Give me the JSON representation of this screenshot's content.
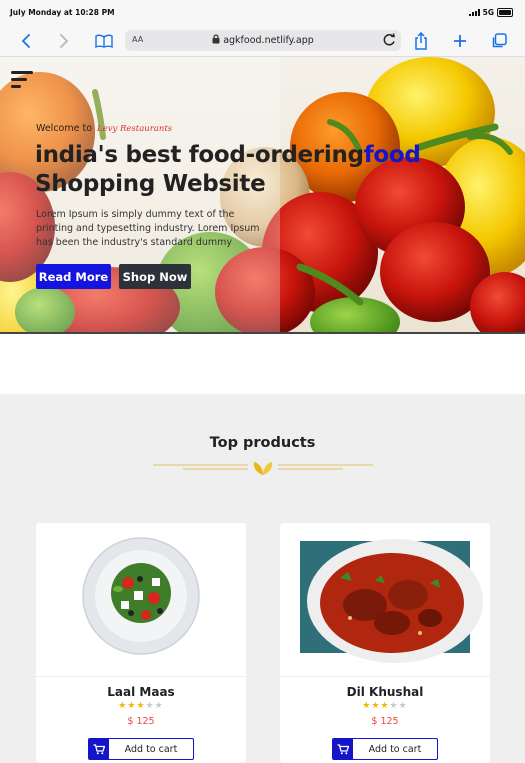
{
  "status_bar": {
    "time": "July Monday at 10:28 PM",
    "network": "5G"
  },
  "browser": {
    "text_size_label": "AA",
    "url": "agkfood.netlify.app",
    "icons": [
      "back-icon",
      "forward-icon",
      "bookmarks-icon",
      "lock-icon",
      "reload-icon",
      "share-icon",
      "new-tab-icon",
      "tabs-icon"
    ]
  },
  "hero": {
    "welcome": "Welcome to",
    "brand": "Levy Restaurants",
    "headline_line1": "india's best food-ordering",
    "headline_highlight": "food",
    "headline_line2": "Shopping Website",
    "description": "Lorem Ipsum is simply dummy text of the printing and typesetting industry. Lorem Ipsum has been the industry's standard dummy",
    "read_more": "Read More",
    "shop_now": "Shop Now"
  },
  "section": {
    "title": "Top products"
  },
  "products": [
    {
      "name": "Laal Maas",
      "price": "$ 125",
      "rating": 3,
      "max_rating": 5,
      "cart_label": "Add to cart"
    },
    {
      "name": "Dil Khushal",
      "price": "$ 125",
      "rating": 3,
      "max_rating": 5,
      "cart_label": "Add to cart"
    }
  ],
  "colors": {
    "accent": "#1414e0",
    "dark_button": "#2c313a",
    "price": "#e44444",
    "star": "#f2b705"
  }
}
